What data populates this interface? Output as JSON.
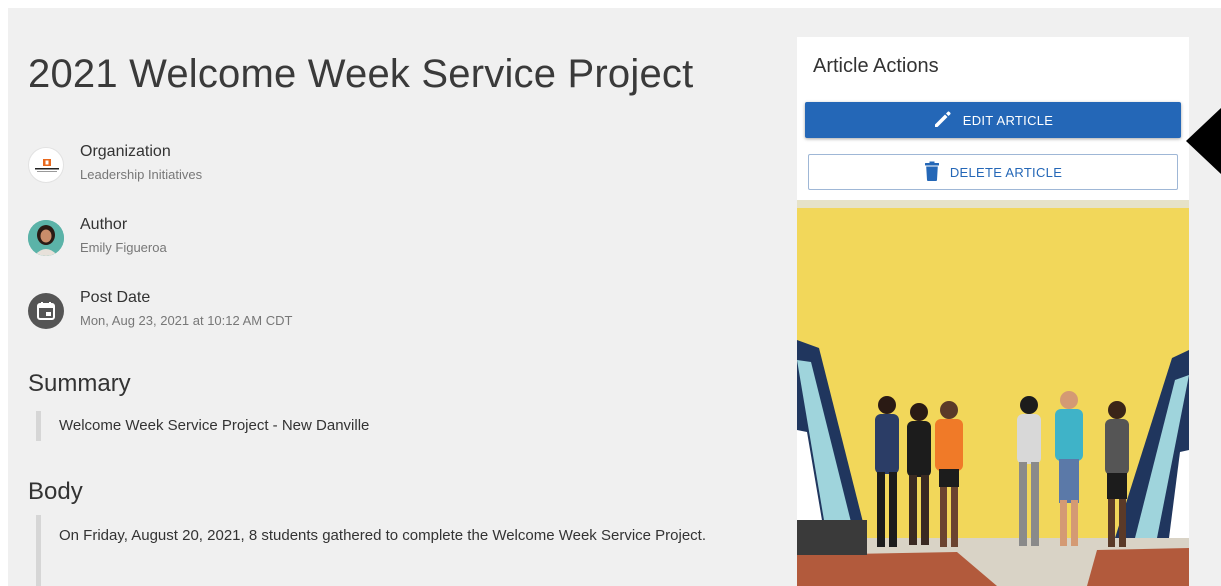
{
  "article": {
    "title": "2021 Welcome Week Service Project",
    "organization_label": "Organization",
    "organization_value": "Leadership Initiatives",
    "author_label": "Author",
    "author_value": "Emily Figueroa",
    "post_date_label": "Post Date",
    "post_date_value": "Mon, Aug 23, 2021 at 10:12 AM CDT",
    "summary_heading": "Summary",
    "summary_text": "Welcome Week Service Project - New Danville",
    "body_heading": "Body",
    "body_text": "On Friday, August 20, 2021, 8 students gathered to complete the Welcome Week Service Project."
  },
  "sidebar": {
    "title": "Article Actions",
    "edit_label": "EDIT ARTICLE",
    "delete_label": "DELETE ARTICLE"
  },
  "icons": {
    "edit": "pencil-icon",
    "delete": "trash-icon",
    "date": "calendar-icon",
    "pointer": "arrow-pointer-icon"
  },
  "colors": {
    "primary": "#2467b7",
    "page_bg": "#f0f0f0",
    "panel_bg": "#ffffff",
    "wall": "#f2d75a"
  }
}
